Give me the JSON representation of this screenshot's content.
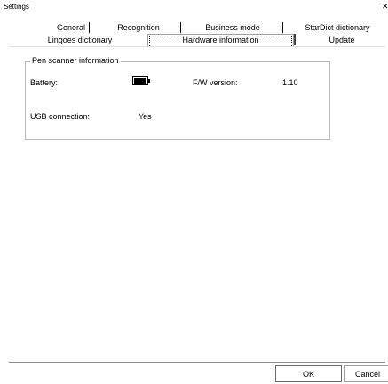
{
  "window": {
    "title": "Settings",
    "close_glyph": "✕"
  },
  "tabs": {
    "row1": [
      "General",
      "Recognition",
      "Business mode",
      "StarDict dictionary"
    ],
    "row2": [
      "Lingoes dictionary",
      "Hardware information",
      "Update"
    ],
    "selected": "Hardware information"
  },
  "pen_scanner": {
    "group_title": "Pen scanner information",
    "battery_label": "Battery:",
    "battery_icon": "battery-full-icon",
    "battery_level": 1.0,
    "fw_label": "F/W version:",
    "fw_value": "1.10",
    "usb_label": "USB connection:",
    "usb_value": "Yes"
  },
  "buttons": {
    "ok": "OK",
    "cancel": "Cancel"
  },
  "colors": {
    "background": "#ffffff",
    "border": "#b8b8b8",
    "text": "#000000"
  }
}
